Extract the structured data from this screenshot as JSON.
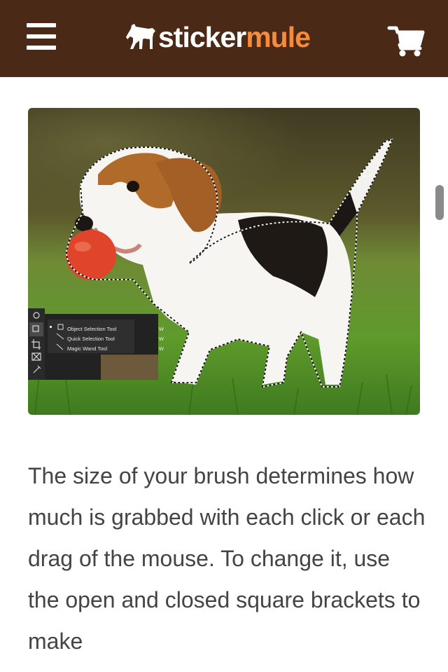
{
  "header": {
    "logo": {
      "word_primary": "sticker",
      "word_accent": "mule"
    },
    "icons": {
      "menu": "hamburger-menu-icon",
      "cart": "shopping-cart-icon",
      "logo": "mule-icon"
    }
  },
  "hero_image": {
    "description_tag": "beagle-puppy-with-selection-outline",
    "tool_menu": {
      "items": [
        {
          "label": "Object Selection Tool",
          "shortcut": "W"
        },
        {
          "label": "Quick Selection Tool",
          "shortcut": "W"
        },
        {
          "label": "Magic Wand Tool",
          "shortcut": "W"
        }
      ]
    }
  },
  "article": {
    "paragraph": "The size of your brush determines how much is grabbed with each click or each drag of the mouse. To change it, use the open and closed square brackets to make"
  },
  "colors": {
    "header_bg": "#4a2a17",
    "brand_accent": "#f68b3c",
    "text": "#444444"
  }
}
